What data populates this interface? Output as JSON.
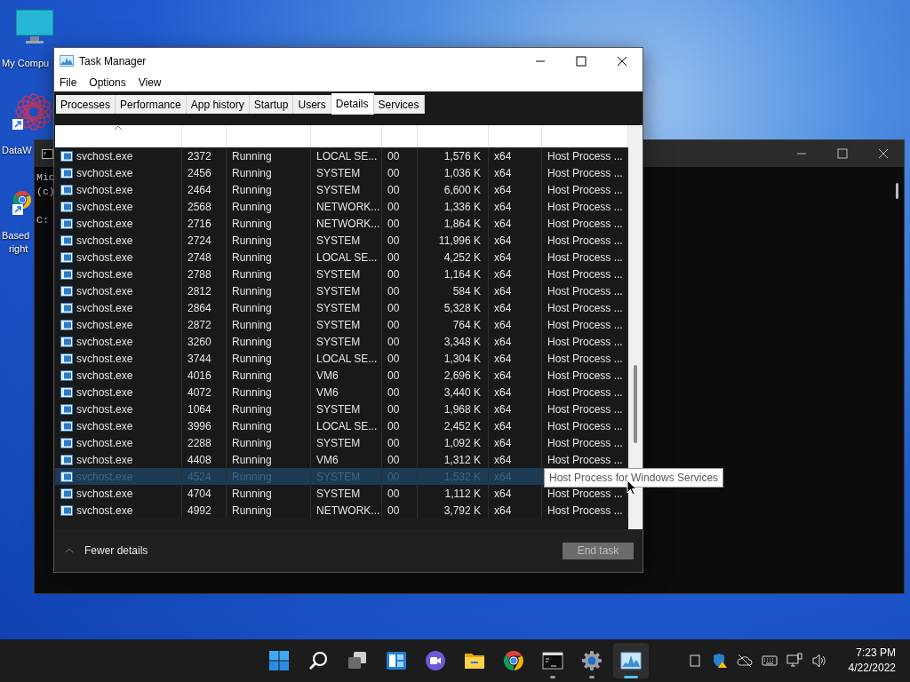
{
  "desktop_icons": [
    {
      "kind": "monitor",
      "shortcut": false,
      "lines": [
        "My Compu"
      ]
    },
    {
      "kind": "mandala",
      "shortcut": true,
      "lines": [
        "DataW"
      ]
    },
    {
      "kind": "browser",
      "shortcut": true,
      "lines": [
        "Based",
        "right"
      ]
    }
  ],
  "console_window": {
    "lines": [
      "Mic",
      "(c)",
      "C:"
    ]
  },
  "task_manager": {
    "title": "Task Manager",
    "menu": [
      "File",
      "Options",
      "View"
    ],
    "tabs": [
      {
        "label": "Processes",
        "selected": false
      },
      {
        "label": "Performance",
        "selected": false
      },
      {
        "label": "App history",
        "selected": false
      },
      {
        "label": "Startup",
        "selected": false
      },
      {
        "label": "Users",
        "selected": false
      },
      {
        "label": "Details",
        "selected": true
      },
      {
        "label": "Services",
        "selected": false
      }
    ],
    "rows": [
      {
        "selected": false,
        "cells": [
          "svchost.exe",
          "2372",
          "Running",
          "LOCAL SE...",
          "00",
          "1,576 K",
          "x64",
          "Host Process ..."
        ]
      },
      {
        "selected": false,
        "cells": [
          "svchost.exe",
          "2456",
          "Running",
          "SYSTEM",
          "00",
          "1,036 K",
          "x64",
          "Host Process ..."
        ]
      },
      {
        "selected": false,
        "cells": [
          "svchost.exe",
          "2464",
          "Running",
          "SYSTEM",
          "00",
          "6,600 K",
          "x64",
          "Host Process ..."
        ]
      },
      {
        "selected": false,
        "cells": [
          "svchost.exe",
          "2568",
          "Running",
          "NETWORK...",
          "00",
          "1,336 K",
          "x64",
          "Host Process ..."
        ]
      },
      {
        "selected": false,
        "cells": [
          "svchost.exe",
          "2716",
          "Running",
          "NETWORK...",
          "00",
          "1,864 K",
          "x64",
          "Host Process ..."
        ]
      },
      {
        "selected": false,
        "cells": [
          "svchost.exe",
          "2724",
          "Running",
          "SYSTEM",
          "00",
          "11,996 K",
          "x64",
          "Host Process ..."
        ]
      },
      {
        "selected": false,
        "cells": [
          "svchost.exe",
          "2748",
          "Running",
          "LOCAL SE...",
          "00",
          "4,252 K",
          "x64",
          "Host Process ..."
        ]
      },
      {
        "selected": false,
        "cells": [
          "svchost.exe",
          "2788",
          "Running",
          "SYSTEM",
          "00",
          "1,164 K",
          "x64",
          "Host Process ..."
        ]
      },
      {
        "selected": false,
        "cells": [
          "svchost.exe",
          "2812",
          "Running",
          "SYSTEM",
          "00",
          "584 K",
          "x64",
          "Host Process ..."
        ]
      },
      {
        "selected": false,
        "cells": [
          "svchost.exe",
          "2864",
          "Running",
          "SYSTEM",
          "00",
          "5,328 K",
          "x64",
          "Host Process ..."
        ]
      },
      {
        "selected": false,
        "cells": [
          "svchost.exe",
          "2872",
          "Running",
          "SYSTEM",
          "00",
          "764 K",
          "x64",
          "Host Process ..."
        ]
      },
      {
        "selected": false,
        "cells": [
          "svchost.exe",
          "3260",
          "Running",
          "SYSTEM",
          "00",
          "3,348 K",
          "x64",
          "Host Process ..."
        ]
      },
      {
        "selected": false,
        "cells": [
          "svchost.exe",
          "3744",
          "Running",
          "LOCAL SE...",
          "00",
          "1,304 K",
          "x64",
          "Host Process ..."
        ]
      },
      {
        "selected": false,
        "cells": [
          "svchost.exe",
          "4016",
          "Running",
          "VM6",
          "00",
          "2,696 K",
          "x64",
          "Host Process ..."
        ]
      },
      {
        "selected": false,
        "cells": [
          "svchost.exe",
          "4072",
          "Running",
          "VM6",
          "00",
          "3,440 K",
          "x64",
          "Host Process ..."
        ]
      },
      {
        "selected": false,
        "cells": [
          "svchost.exe",
          "1064",
          "Running",
          "SYSTEM",
          "00",
          "1,968 K",
          "x64",
          "Host Process ..."
        ]
      },
      {
        "selected": false,
        "cells": [
          "svchost.exe",
          "3996",
          "Running",
          "LOCAL SE...",
          "00",
          "2,452 K",
          "x64",
          "Host Process ..."
        ]
      },
      {
        "selected": false,
        "cells": [
          "svchost.exe",
          "2288",
          "Running",
          "SYSTEM",
          "00",
          "1,092 K",
          "x64",
          "Host Process ..."
        ]
      },
      {
        "selected": false,
        "cells": [
          "svchost.exe",
          "4408",
          "Running",
          "VM6",
          "00",
          "1,312 K",
          "x64",
          "Host Process ..."
        ]
      },
      {
        "selected": true,
        "cells": [
          "svchost.exe",
          "4524",
          "Running",
          "SYSTEM",
          "00",
          "1,532 K",
          "x64"
        ]
      },
      {
        "selected": false,
        "cells": [
          "svchost.exe",
          "4704",
          "Running",
          "SYSTEM",
          "00",
          "1,112 K",
          "x64",
          "Host Process ..."
        ]
      },
      {
        "selected": false,
        "cells": [
          "svchost.exe",
          "4992",
          "Running",
          "NETWORK...",
          "00",
          "3,792 K",
          "x64",
          "Host Process ..."
        ]
      }
    ],
    "tooltip": "Host Process for Windows Services",
    "details_toggle": "Fewer details",
    "end_task": {
      "label": "End task",
      "disabled": true
    }
  },
  "taskbar": {
    "apps": [
      {
        "kind": "start",
        "running": false,
        "selected": false
      },
      {
        "kind": "search",
        "running": false,
        "selected": false
      },
      {
        "kind": "task-view",
        "running": false,
        "selected": false
      },
      {
        "kind": "widgets",
        "running": false,
        "selected": false
      },
      {
        "kind": "chat",
        "running": false,
        "selected": false
      },
      {
        "kind": "folder",
        "running": false,
        "selected": false
      },
      {
        "kind": "browser",
        "running": false,
        "selected": false
      },
      {
        "kind": "terminal",
        "running": true,
        "selected": false
      },
      {
        "kind": "settings",
        "running": true,
        "selected": false
      },
      {
        "kind": "monitor-chart",
        "running": true,
        "selected": true
      }
    ],
    "clock": {
      "time": "7:23 PM",
      "date": "4/22/2022"
    }
  }
}
